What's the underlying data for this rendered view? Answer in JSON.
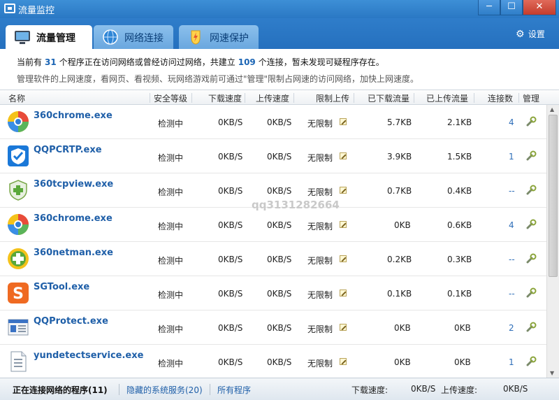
{
  "window": {
    "title": "流量监控",
    "min": "─",
    "max": "☐",
    "close": "✕"
  },
  "tabs": [
    {
      "label": "流量管理"
    },
    {
      "label": "网络连接"
    },
    {
      "label": "网速保护"
    }
  ],
  "settings_label": "设置",
  "info": {
    "prefix": "当前有",
    "programs": "31",
    "middle": "个程序正在访问网络或曾经访问过网络，共建立",
    "connections": "109",
    "suffix": "个连接，暂未发现可疑程序存在。",
    "tip": "管理软件的上网速度，看网页、看视频、玩网络游戏前可通过\"管理\"限制占网速的访问网络，加快上网速度。"
  },
  "columns": {
    "name": "名称",
    "security": "安全等级",
    "download": "下载速度",
    "upload": "上传速度",
    "limit": "限制上传",
    "downloaded": "已下载流量",
    "uploaded": "已上传流量",
    "conn": "连接数",
    "manage": "管理"
  },
  "rows": [
    {
      "name": "360chrome.exe",
      "icon": "360chrome-icon",
      "security": "检测中",
      "download": "0KB/S",
      "upload": "0KB/S",
      "limit": "无限制",
      "downloaded": "5.7KB",
      "uploaded": "2.1KB",
      "conn": "4"
    },
    {
      "name": "QQPCRTP.exe",
      "icon": "qqpcrtp-icon",
      "security": "检测中",
      "download": "0KB/S",
      "upload": "0KB/S",
      "limit": "无限制",
      "downloaded": "3.9KB",
      "uploaded": "1.5KB",
      "conn": "1"
    },
    {
      "name": "360tcpview.exe",
      "icon": "360tcpview-icon",
      "security": "检测中",
      "download": "0KB/S",
      "upload": "0KB/S",
      "limit": "无限制",
      "downloaded": "0.7KB",
      "uploaded": "0.4KB",
      "conn": "--"
    },
    {
      "name": "360chrome.exe",
      "icon": "360chrome-icon",
      "security": "检测中",
      "download": "0KB/S",
      "upload": "0KB/S",
      "limit": "无限制",
      "downloaded": "0KB",
      "uploaded": "0.6KB",
      "conn": "4"
    },
    {
      "name": "360netman.exe",
      "icon": "360netman-icon",
      "security": "检测中",
      "download": "0KB/S",
      "upload": "0KB/S",
      "limit": "无限制",
      "downloaded": "0.2KB",
      "uploaded": "0.3KB",
      "conn": "--"
    },
    {
      "name": "SGTool.exe",
      "icon": "sgtool-icon",
      "security": "检测中",
      "download": "0KB/S",
      "upload": "0KB/S",
      "limit": "无限制",
      "downloaded": "0.1KB",
      "uploaded": "0.1KB",
      "conn": "--"
    },
    {
      "name": "QQProtect.exe",
      "icon": "qqprotect-icon",
      "security": "检测中",
      "download": "0KB/S",
      "upload": "0KB/S",
      "limit": "无限制",
      "downloaded": "0KB",
      "uploaded": "0KB",
      "conn": "2"
    },
    {
      "name": "yundetectservice.exe",
      "icon": "document-icon",
      "security": "检测中",
      "download": "0KB/S",
      "upload": "0KB/S",
      "limit": "无限制",
      "downloaded": "0KB",
      "uploaded": "0KB",
      "conn": "1"
    }
  ],
  "watermark": "qq3131282664",
  "status": {
    "connecting": "正在连接网络的程序(11)",
    "hidden": "隐藏的系统服务(20)",
    "all": "所有程序",
    "dl_label": "下载速度:",
    "dl_value": "0KB/S",
    "ul_label": "上传速度:",
    "ul_value": "0KB/S"
  },
  "colors": {
    "titlebar": "#2a78c4",
    "link": "#1f5fa8",
    "accent_number": "#1a64b4"
  }
}
